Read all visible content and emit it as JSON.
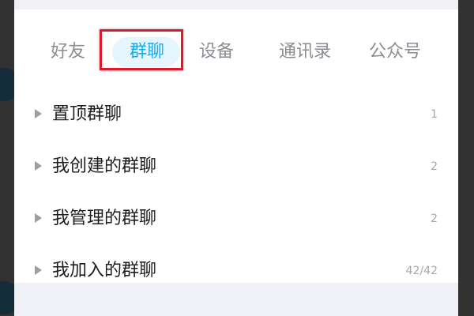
{
  "tabs": [
    {
      "label": "好友"
    },
    {
      "label": "群聊"
    },
    {
      "label": "设备"
    },
    {
      "label": "通讯录"
    },
    {
      "label": "公众号"
    }
  ],
  "active_tab": "群聊",
  "group_sections": [
    {
      "label": "置顶群聊",
      "count": "1"
    },
    {
      "label": "我创建的群聊",
      "count": "2"
    },
    {
      "label": "我管理的群聊",
      "count": "2"
    },
    {
      "label": "我加入的群聊",
      "count": "42/42"
    }
  ],
  "colors": {
    "active_tab_text": "#14aef0",
    "active_tab_pill": "#e6f6ff",
    "highlight_box": "#e1182b",
    "inactive_tab_text": "#8a8d93",
    "row_text": "#1c1d20",
    "count_text": "#a5a7ad"
  },
  "icons": [
    "triangle-right-icon"
  ]
}
